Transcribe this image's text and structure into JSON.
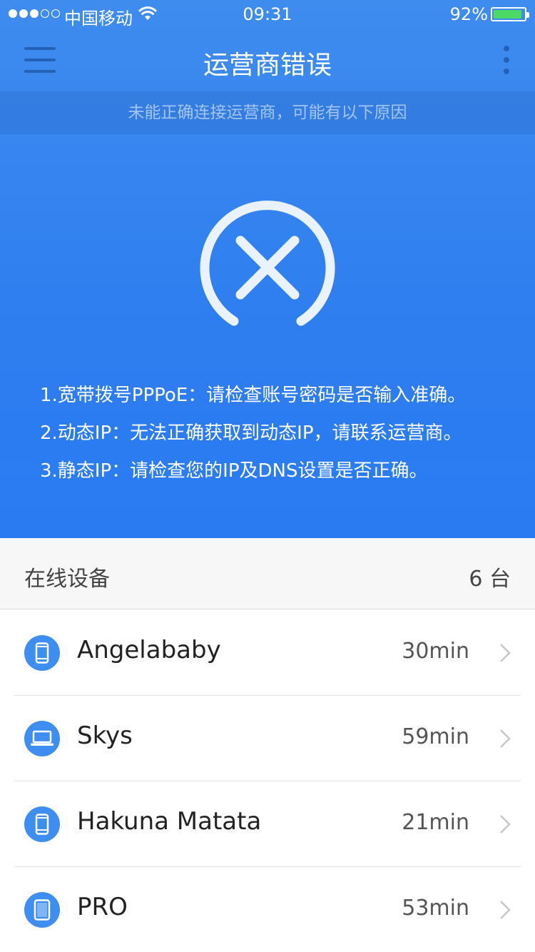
{
  "status_bar": {
    "carrier": "中国移动",
    "time": "09:31",
    "battery": "92%"
  },
  "nav": {
    "title": "运营商错误"
  },
  "notice": "未能正确连接运营商，可能有以下原因",
  "reasons": [
    "1.宽带拨号PPPoE：请检查账号密码是否输入准确。",
    "2.动态IP：无法正确获取到动态IP，请联系运营商。",
    "3.静态IP：请检查您的IP及DNS设置是否正确。"
  ],
  "devices": {
    "header_label": "在线设备",
    "count": "6 台",
    "items": [
      {
        "name": "Angelababy",
        "duration": "30min",
        "icon": "phone-icon"
      },
      {
        "name": "Skys",
        "duration": "59min",
        "icon": "laptop-icon"
      },
      {
        "name": "Hakuna Matata",
        "duration": "21min",
        "icon": "phone-icon"
      },
      {
        "name": "PRO",
        "duration": "53min",
        "icon": "tablet-icon"
      }
    ]
  },
  "colors": {
    "primary": "#2f7ff0",
    "battery": "#4cd964",
    "device_icon_bg": "#3d8ef0"
  }
}
